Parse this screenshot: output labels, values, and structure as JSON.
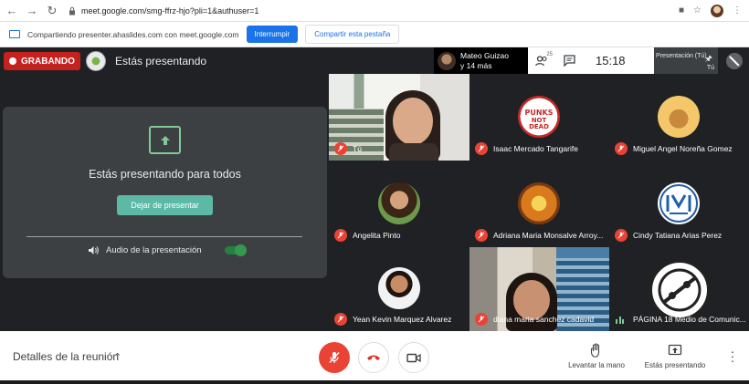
{
  "browser": {
    "url": "meet.google.com/smg-ffrz-hjo?pli=1&authuser=1"
  },
  "share_bar": {
    "message": "Compartiendo presenter.ahaslides.com con meet.google.com",
    "stop_label": "Interrumpir",
    "share_tab_label": "Compartir esta pestaña"
  },
  "header": {
    "recording_label": "GRABANDO",
    "title": "Estás presentando",
    "pinned_name": "Mateo Guizao",
    "pinned_more": "y 14 más",
    "participant_count": "25",
    "time": "15:18",
    "self_label": "Presentación (Tú)",
    "self_sub": "Tú"
  },
  "present_panel": {
    "message": "Estás presentando para todos",
    "stop_button": "Dejar de presentar",
    "audio_label": "Audio de la presentación",
    "audio_on": true
  },
  "participants": [
    {
      "name": "Tú"
    },
    {
      "name": "Isaac Mercado Tangarife"
    },
    {
      "name": "Miguel Angel Noreña Gomez"
    },
    {
      "name": "Angelita Pinto"
    },
    {
      "name": "Adriana Maria Monsalve Arroy..."
    },
    {
      "name": "Cindy Tatiana Arias Perez"
    },
    {
      "name": "Yean Kevin Marquez Alvarez"
    },
    {
      "name": "diana maria sanchez cadavid"
    },
    {
      "name": "PÁGINA 18 Medio de Comunic..."
    }
  ],
  "footer": {
    "details_label": "Detalles de la reunión",
    "raise_hand_label": "Levantar la mano",
    "presenting_label": "Estás presentando"
  },
  "colors": {
    "accent": "#1a73e8",
    "record": "#c5221f",
    "mic_off": "#ea4335",
    "present_green": "#81c995",
    "stop_button": "#5bb9a5"
  }
}
